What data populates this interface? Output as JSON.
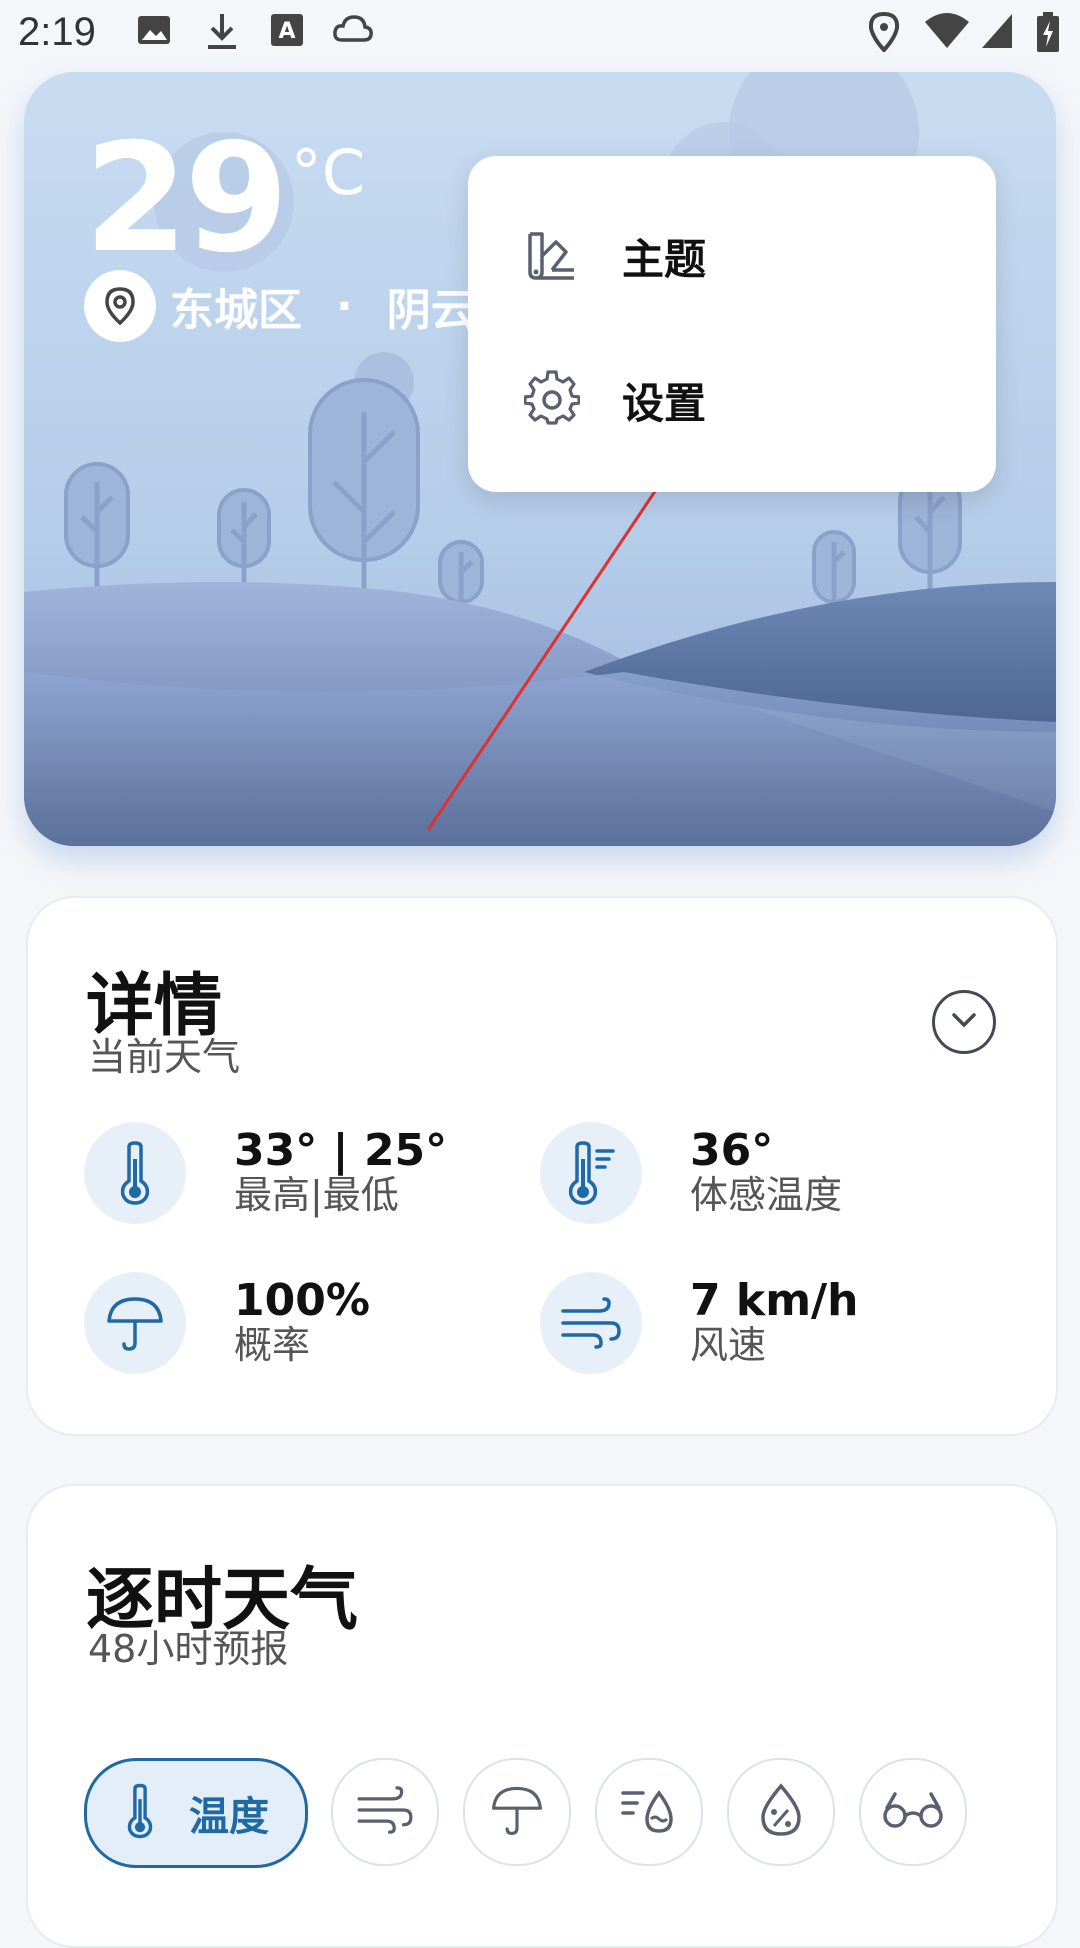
{
  "status_bar": {
    "time": "2:19",
    "left_icons": [
      "image-icon",
      "download-icon",
      "font-icon",
      "cloud-icon"
    ],
    "right_icons": [
      "location-icon",
      "wifi-icon",
      "signal-icon",
      "battery-charging-icon"
    ]
  },
  "current": {
    "temperature": "29",
    "unit": "°C",
    "location": "东城区",
    "separator": "·",
    "condition": "阴云密"
  },
  "menu": {
    "items": [
      {
        "label": "主题",
        "icon": "theme-icon"
      },
      {
        "label": "设置",
        "icon": "gear-icon"
      }
    ]
  },
  "details": {
    "title": "详情",
    "subtitle": "当前天气",
    "stats": [
      {
        "value": "33° | 25°",
        "label": "最高|最低",
        "icon": "thermometer-icon"
      },
      {
        "value": "36°",
        "label": "体感温度",
        "icon": "feels-like-icon"
      },
      {
        "value": "100%",
        "label": "概率",
        "icon": "umbrella-icon"
      },
      {
        "value": "7 km/h",
        "label": "风速",
        "icon": "wind-icon"
      }
    ]
  },
  "hourly": {
    "title": "逐时天气",
    "subtitle": "48小时预报",
    "chips": [
      {
        "label": "温度",
        "icon": "thermometer-icon",
        "active": true
      },
      {
        "icon": "wind-icon"
      },
      {
        "icon": "umbrella-icon"
      },
      {
        "icon": "precipitation-icon"
      },
      {
        "icon": "humidity-icon"
      },
      {
        "icon": "visibility-icon"
      }
    ]
  },
  "colors": {
    "accent": "#1f6aa5",
    "icon_bg": "#e7f0f8",
    "annotation_arrow": "#e03030"
  }
}
